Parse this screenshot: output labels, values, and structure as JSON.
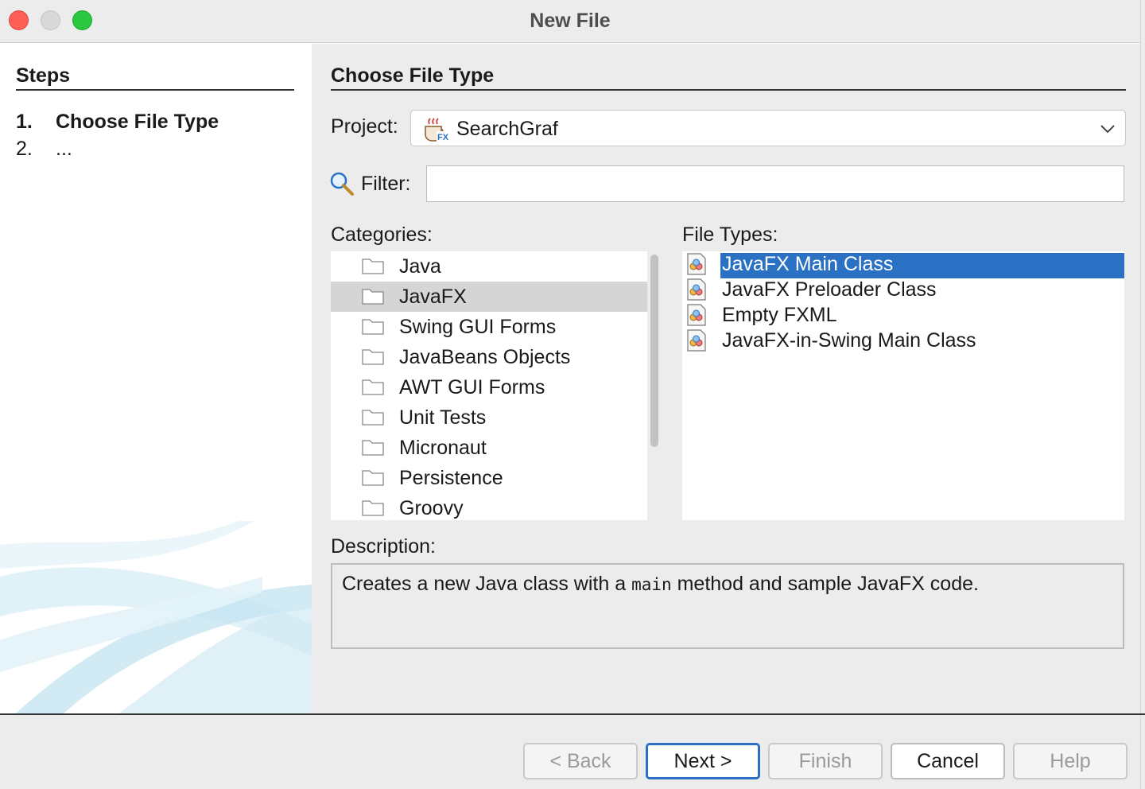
{
  "window": {
    "title": "New File",
    "accent": "#2a71c4"
  },
  "steps": {
    "title": "Steps",
    "items": [
      {
        "num": "1.",
        "label": "Choose File Type"
      },
      {
        "num": "2.",
        "label": "..."
      }
    ]
  },
  "main": {
    "title": "Choose File Type",
    "project": {
      "label": "Project:",
      "value": "SearchGraf",
      "icon": "javafx-project-icon"
    },
    "filter": {
      "label": "Filter:",
      "value": "",
      "placeholder": ""
    },
    "categories": {
      "label": "Categories:",
      "selected": "JavaFX",
      "items": [
        "Java",
        "JavaFX",
        "Swing GUI Forms",
        "JavaBeans Objects",
        "AWT GUI Forms",
        "Unit Tests",
        "Micronaut",
        "Persistence",
        "Groovy"
      ]
    },
    "file_types": {
      "label": "File Types:",
      "selected": "JavaFX Main Class",
      "items": [
        "JavaFX Main Class",
        "JavaFX Preloader Class",
        "Empty FXML",
        "JavaFX-in-Swing Main Class"
      ]
    },
    "description": {
      "label": "Description:",
      "before": "Creates a new Java class with a ",
      "code": "main",
      "after": " method and sample JavaFX code."
    }
  },
  "buttons": {
    "back": "< Back",
    "next": "Next >",
    "finish": "Finish",
    "cancel": "Cancel",
    "help": "Help"
  }
}
